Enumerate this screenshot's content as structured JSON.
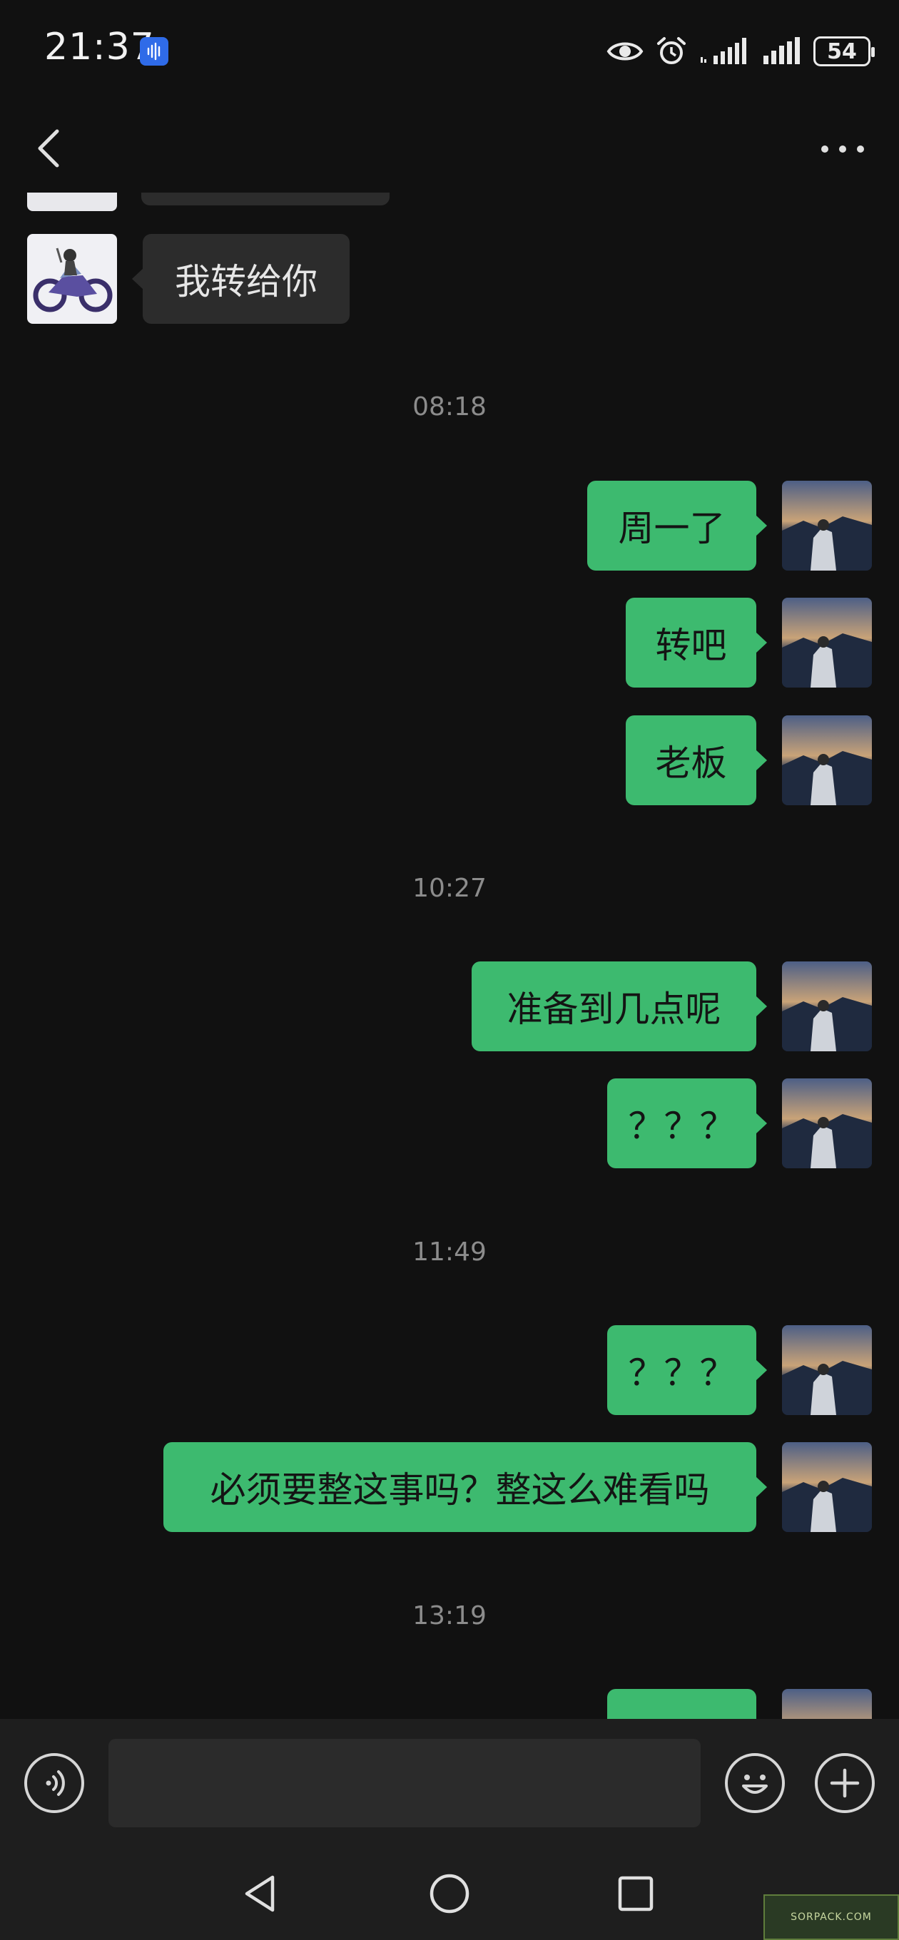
{
  "status_bar": {
    "time": "21:37",
    "battery": "54",
    "icons": [
      "voice-recorder-icon",
      "eye-icon",
      "alarm-icon",
      "signal-icon",
      "signal-icon",
      "battery-icon"
    ]
  },
  "header": {
    "back_icon": "chevron-left-icon",
    "more_icon": "more-dots-icon"
  },
  "messages": [
    {
      "side": "in",
      "text": "我转给你"
    },
    {
      "type": "timestamp",
      "text": "08:18"
    },
    {
      "side": "out",
      "text": "周一了"
    },
    {
      "side": "out",
      "text": "转吧"
    },
    {
      "side": "out",
      "text": "老板"
    },
    {
      "type": "timestamp",
      "text": "10:27"
    },
    {
      "side": "out",
      "text": "准备到几点呢"
    },
    {
      "side": "out",
      "text": "？？？"
    },
    {
      "type": "timestamp",
      "text": "11:49"
    },
    {
      "side": "out",
      "text": "？？？"
    },
    {
      "side": "out",
      "text": "必须要整这事吗？整这么难看吗"
    },
    {
      "type": "timestamp",
      "text": "13:19"
    }
  ],
  "input": {
    "value": "",
    "placeholder": ""
  },
  "colors": {
    "background": "#111111",
    "outgoing_bubble": "#3dba6f",
    "incoming_bubble": "#2c2c2c",
    "timestamp": "#8c8c8c",
    "input_bar": "#1e1e1e"
  },
  "watermark": "SORPACK.COM"
}
